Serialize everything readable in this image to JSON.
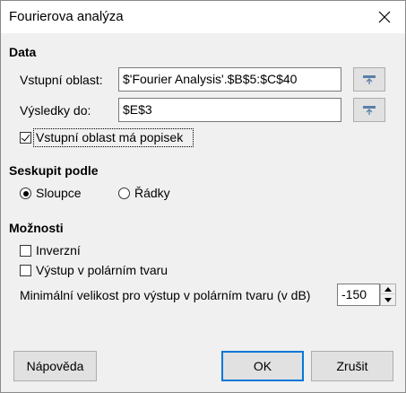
{
  "window": {
    "title": "Fourierova analýza"
  },
  "data_section": {
    "heading": "Data",
    "input_range_label": "Vstupní oblast:",
    "input_range_value": "$'Fourier Analysis'.$B$5:$C$40",
    "output_label": "Výsledky do:",
    "output_value": "$E$3",
    "has_label_checkbox": {
      "label": "Vstupní oblast má popisek",
      "checked": true
    }
  },
  "group_section": {
    "heading": "Seskupit podle",
    "options": [
      {
        "label": "Sloupce",
        "checked": true
      },
      {
        "label": "Řádky",
        "checked": false
      }
    ]
  },
  "options_section": {
    "heading": "Možnosti",
    "inverse": {
      "label": "Inverzní",
      "checked": false
    },
    "polar": {
      "label": "Výstup v polárním tvaru",
      "checked": false
    },
    "min_magnitude_label": "Minimální velikost pro výstup v polárním tvaru (v dB)",
    "min_magnitude_value": "-150"
  },
  "buttons": {
    "help": "Nápověda",
    "ok": "OK",
    "cancel": "Zrušit"
  },
  "icons": {
    "close": "close-icon",
    "shrink": "shrink-range-icon",
    "spin_up": "chevron-up-icon",
    "spin_down": "chevron-down-icon"
  }
}
